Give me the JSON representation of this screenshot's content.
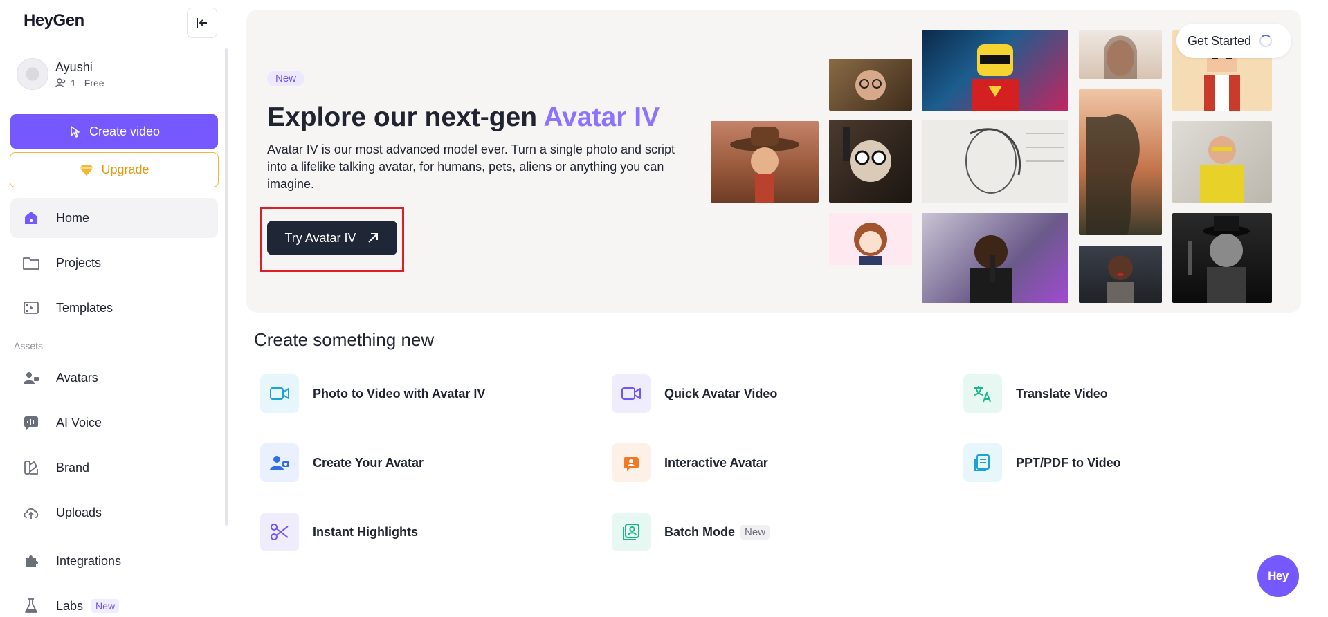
{
  "app": {
    "logo_text": "HeyGen"
  },
  "profile": {
    "name": "Ayushi",
    "members": "1",
    "plan": "Free"
  },
  "sidebar": {
    "create_label": "Create video",
    "upgrade_label": "Upgrade",
    "items": [
      {
        "label": "Home",
        "icon": "home-icon"
      },
      {
        "label": "Projects",
        "icon": "folder-icon"
      },
      {
        "label": "Templates",
        "icon": "film-icon"
      },
      {
        "label": "Avatars",
        "icon": "user-icon"
      },
      {
        "label": "AI Voice",
        "icon": "waveform-icon"
      },
      {
        "label": "Brand",
        "icon": "palette-icon"
      },
      {
        "label": "Uploads",
        "icon": "cloud-upload-icon"
      },
      {
        "label": "Integrations",
        "icon": "puzzle-icon"
      },
      {
        "label": "Labs",
        "icon": "flask-icon",
        "badge": "New"
      }
    ],
    "assets_label": "Assets"
  },
  "hero": {
    "badge": "New",
    "title_main": "Explore our next-gen ",
    "title_accent": "Avatar IV",
    "description": "Avatar IV is our most advanced model ever. Turn a single photo and script into a lifelike talking avatar, for humans, pets, aliens or anything you can imagine.",
    "cta_label": "Try Avatar IV",
    "get_started_label": "Get Started"
  },
  "create": {
    "title": "Create something new",
    "features": [
      {
        "label": "Photo to Video with Avatar IV",
        "icon": "video-camera-icon"
      },
      {
        "label": "Quick Avatar Video",
        "icon": "video-camera-icon"
      },
      {
        "label": "Translate Video",
        "icon": "translate-icon"
      },
      {
        "label": "Create Your Avatar",
        "icon": "add-user-icon"
      },
      {
        "label": "Interactive Avatar",
        "icon": "chat-avatar-icon"
      },
      {
        "label": "PPT/PDF to Video",
        "icon": "document-icon"
      },
      {
        "label": "Instant Highlights",
        "icon": "scissors-icon"
      },
      {
        "label": "Batch Mode",
        "icon": "batch-icon",
        "badge": "New"
      }
    ]
  },
  "fab": {
    "label": "Hey"
  },
  "colors": {
    "accent": "#7559ff",
    "upgrade": "#f4b63f",
    "highlight": "#dd1f2a",
    "dark_button": "#1f2736"
  }
}
